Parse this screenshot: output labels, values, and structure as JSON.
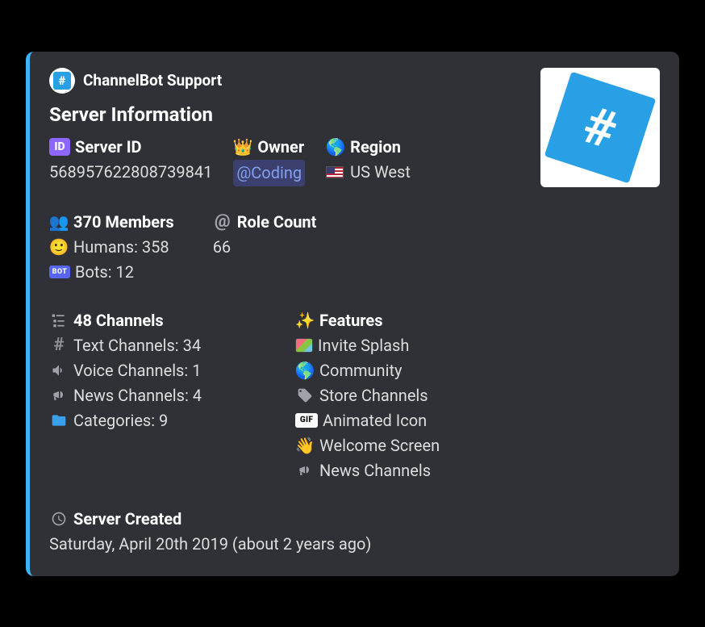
{
  "author": {
    "name": "ChannelBot Support"
  },
  "title": "Server Information",
  "server_id": {
    "label": "Server ID",
    "value": "568957622808739841"
  },
  "owner": {
    "label": "Owner",
    "mention": "@Coding"
  },
  "region": {
    "label": "Region",
    "value": "US West"
  },
  "members": {
    "label": "370 Members",
    "humans": "Humans: 358",
    "bots": "Bots: 12"
  },
  "role_count": {
    "label": "Role Count",
    "value": "66"
  },
  "channels": {
    "label": "48 Channels",
    "text": "Text Channels: 34",
    "voice": "Voice Channels: 1",
    "news": "News Channels: 4",
    "categories": "Categories: 9"
  },
  "features": {
    "label": "Features",
    "invite_splash": "Invite Splash",
    "community": "Community",
    "store_channels": "Store Channels",
    "animated_icon": "Animated Icon",
    "welcome_screen": "Welcome Screen",
    "news_channels": "News Channels"
  },
  "created": {
    "label": "Server Created",
    "value": "Saturday, April 20th 2019 (about 2 years ago)"
  }
}
